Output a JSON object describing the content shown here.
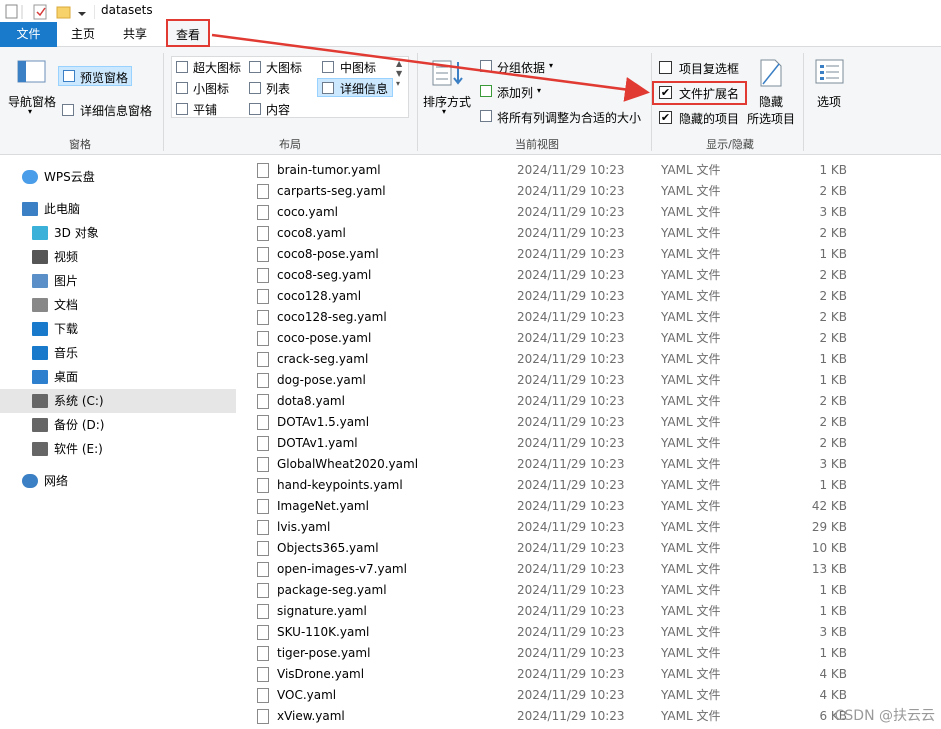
{
  "window": {
    "title": "datasets"
  },
  "tabs": {
    "file": "文件",
    "home": "主页",
    "share": "共享",
    "view": "查看"
  },
  "ribbon": {
    "panes": {
      "nav_pane": "导航窗格",
      "preview_pane": "预览窗格",
      "details_pane": "详细信息窗格",
      "group_label": "窗格"
    },
    "layout": {
      "xl_icons": "超大图标",
      "large_icons": "大图标",
      "medium_icons": "中图标",
      "small_icons": "小图标",
      "list": "列表",
      "details": "详细信息",
      "tiles": "平铺",
      "content": "内容",
      "group_label": "布局"
    },
    "current_view": {
      "sort_by": "排序方式",
      "group_by": "分组依据",
      "add_columns": "添加列",
      "size_all_columns": "将所有列调整为合适的大小",
      "group_label": "当前视图"
    },
    "show_hide": {
      "item_checkboxes": "项目复选框",
      "item_checkboxes_checked": false,
      "file_extensions": "文件扩展名",
      "file_extensions_checked": true,
      "hidden_items": "隐藏的项目",
      "hidden_items_checked": true,
      "hide_selected_line1": "隐藏",
      "hide_selected_line2": "所选项目",
      "group_label": "显示/隐藏"
    },
    "options": "选项"
  },
  "nav": {
    "items": [
      {
        "label": "WPS云盘",
        "icon": "cloud-icon"
      },
      {
        "label": "此电脑",
        "icon": "computer-icon"
      },
      {
        "label": "3D 对象",
        "icon": "3d-objects-icon"
      },
      {
        "label": "视频",
        "icon": "video-icon"
      },
      {
        "label": "图片",
        "icon": "pictures-icon"
      },
      {
        "label": "文档",
        "icon": "documents-icon"
      },
      {
        "label": "下载",
        "icon": "download-icon"
      },
      {
        "label": "音乐",
        "icon": "music-icon"
      },
      {
        "label": "桌面",
        "icon": "desktop-icon"
      },
      {
        "label": "系统 (C:)",
        "icon": "drive-icon"
      },
      {
        "label": "备份 (D:)",
        "icon": "drive-icon"
      },
      {
        "label": "软件 (E:)",
        "icon": "drive-icon"
      },
      {
        "label": "网络",
        "icon": "network-icon"
      }
    ]
  },
  "files": [
    {
      "name": "brain-tumor.yaml",
      "date": "2024/11/29 10:23",
      "type": "YAML 文件",
      "size": "1 KB"
    },
    {
      "name": "carparts-seg.yaml",
      "date": "2024/11/29 10:23",
      "type": "YAML 文件",
      "size": "2 KB"
    },
    {
      "name": "coco.yaml",
      "date": "2024/11/29 10:23",
      "type": "YAML 文件",
      "size": "3 KB"
    },
    {
      "name": "coco8.yaml",
      "date": "2024/11/29 10:23",
      "type": "YAML 文件",
      "size": "2 KB"
    },
    {
      "name": "coco8-pose.yaml",
      "date": "2024/11/29 10:23",
      "type": "YAML 文件",
      "size": "1 KB"
    },
    {
      "name": "coco8-seg.yaml",
      "date": "2024/11/29 10:23",
      "type": "YAML 文件",
      "size": "2 KB"
    },
    {
      "name": "coco128.yaml",
      "date": "2024/11/29 10:23",
      "type": "YAML 文件",
      "size": "2 KB"
    },
    {
      "name": "coco128-seg.yaml",
      "date": "2024/11/29 10:23",
      "type": "YAML 文件",
      "size": "2 KB"
    },
    {
      "name": "coco-pose.yaml",
      "date": "2024/11/29 10:23",
      "type": "YAML 文件",
      "size": "2 KB"
    },
    {
      "name": "crack-seg.yaml",
      "date": "2024/11/29 10:23",
      "type": "YAML 文件",
      "size": "1 KB"
    },
    {
      "name": "dog-pose.yaml",
      "date": "2024/11/29 10:23",
      "type": "YAML 文件",
      "size": "1 KB"
    },
    {
      "name": "dota8.yaml",
      "date": "2024/11/29 10:23",
      "type": "YAML 文件",
      "size": "2 KB"
    },
    {
      "name": "DOTAv1.5.yaml",
      "date": "2024/11/29 10:23",
      "type": "YAML 文件",
      "size": "2 KB"
    },
    {
      "name": "DOTAv1.yaml",
      "date": "2024/11/29 10:23",
      "type": "YAML 文件",
      "size": "2 KB"
    },
    {
      "name": "GlobalWheat2020.yaml",
      "date": "2024/11/29 10:23",
      "type": "YAML 文件",
      "size": "3 KB"
    },
    {
      "name": "hand-keypoints.yaml",
      "date": "2024/11/29 10:23",
      "type": "YAML 文件",
      "size": "1 KB"
    },
    {
      "name": "ImageNet.yaml",
      "date": "2024/11/29 10:23",
      "type": "YAML 文件",
      "size": "42 KB"
    },
    {
      "name": "lvis.yaml",
      "date": "2024/11/29 10:23",
      "type": "YAML 文件",
      "size": "29 KB"
    },
    {
      "name": "Objects365.yaml",
      "date": "2024/11/29 10:23",
      "type": "YAML 文件",
      "size": "10 KB"
    },
    {
      "name": "open-images-v7.yaml",
      "date": "2024/11/29 10:23",
      "type": "YAML 文件",
      "size": "13 KB"
    },
    {
      "name": "package-seg.yaml",
      "date": "2024/11/29 10:23",
      "type": "YAML 文件",
      "size": "1 KB"
    },
    {
      "name": "signature.yaml",
      "date": "2024/11/29 10:23",
      "type": "YAML 文件",
      "size": "1 KB"
    },
    {
      "name": "SKU-110K.yaml",
      "date": "2024/11/29 10:23",
      "type": "YAML 文件",
      "size": "3 KB"
    },
    {
      "name": "tiger-pose.yaml",
      "date": "2024/11/29 10:23",
      "type": "YAML 文件",
      "size": "1 KB"
    },
    {
      "name": "VisDrone.yaml",
      "date": "2024/11/29 10:23",
      "type": "YAML 文件",
      "size": "4 KB"
    },
    {
      "name": "VOC.yaml",
      "date": "2024/11/29 10:23",
      "type": "YAML 文件",
      "size": "4 KB"
    },
    {
      "name": "xView.yaml",
      "date": "2024/11/29 10:23",
      "type": "YAML 文件",
      "size": "6 KB"
    }
  ],
  "watermark": "CSDN @扶云云",
  "colors": {
    "accent": "#1979ca",
    "highlight": "#e03a33",
    "selection": "#cce8ff"
  }
}
